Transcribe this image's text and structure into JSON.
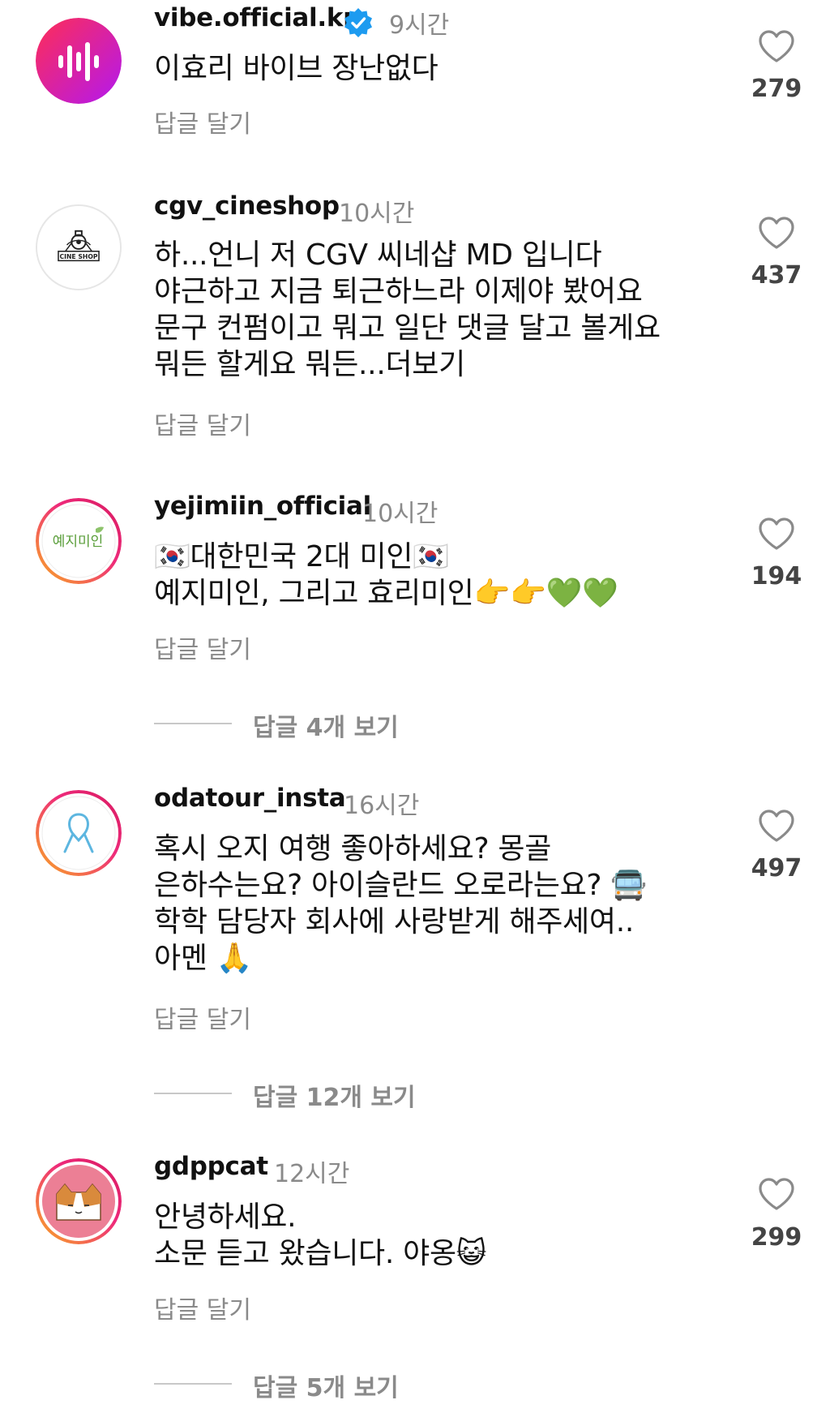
{
  "comments": [
    {
      "username": "vibe.official.kr",
      "verified": true,
      "time": "9시간",
      "lines": [
        "이효리 바이브 장난없다"
      ],
      "reply_label": "답글 달기",
      "likes": "279",
      "avatar_icon": "vibe-logo-icon"
    },
    {
      "username": "cgv_cineshop",
      "verified": false,
      "time": "10시간",
      "lines": [
        "하...언니 저 CGV 씨네샵 MD 입니다",
        "야근하고 지금 퇴근하느라 이제야 봤어요",
        "문구 컨펌이고 뭐고 일단 댓글 달고 볼게요",
        "뭐든 할게요 뭐든...더보기"
      ],
      "reply_label": "답글 달기",
      "likes": "437",
      "avatar_text": "CINE SHOP",
      "avatar_icon": "cineshop-logo-icon"
    },
    {
      "username": "yejimiin_official",
      "verified": false,
      "time": "10시간",
      "lines": [
        "🇰🇷대한민국 2대 미인🇰🇷",
        "예지미인, 그리고 효리미인👉👉💚💚"
      ],
      "reply_label": "답글 달기",
      "likes": "194",
      "avatar_text": "예지미인",
      "avatar_icon": "yejimiin-logo-icon",
      "view_replies": "답글 4개 보기"
    },
    {
      "username": "odatour_insta",
      "verified": false,
      "time": "16시간",
      "lines": [
        "혹시 오지 여행 좋아하세요? 몽골",
        "은하수는요? 아이슬란드 오로라는요? 🚍",
        "학학 담당자 회사에 사랑받게 해주세여..",
        "아멘 🙏"
      ],
      "reply_label": "답글 달기",
      "likes": "497",
      "avatar_icon": "odatour-logo-icon",
      "view_replies": "답글 12개 보기"
    },
    {
      "username": "gdppcat",
      "verified": false,
      "time": "12시간",
      "lines": [
        "안녕하세요.",
        "소문 듣고 왔습니다. 야옹😺"
      ],
      "reply_label": "답글 달기",
      "likes": "299",
      "avatar_icon": "cat-avatar-icon",
      "view_replies": "답글 5개 보기"
    }
  ],
  "colors": {
    "vibe_gradient_start": "#ff2d55",
    "vibe_gradient_end": "#b318f0",
    "story_ring_start": "#f9a825",
    "story_ring_end": "#d81b60",
    "verified_blue": "#1d9bf0",
    "muted_gray": "#8a8a8a",
    "yejimiin_green": "#5a9e3a",
    "odatour_blue": "#5db6e0",
    "cat_pink": "#ec7f95"
  }
}
